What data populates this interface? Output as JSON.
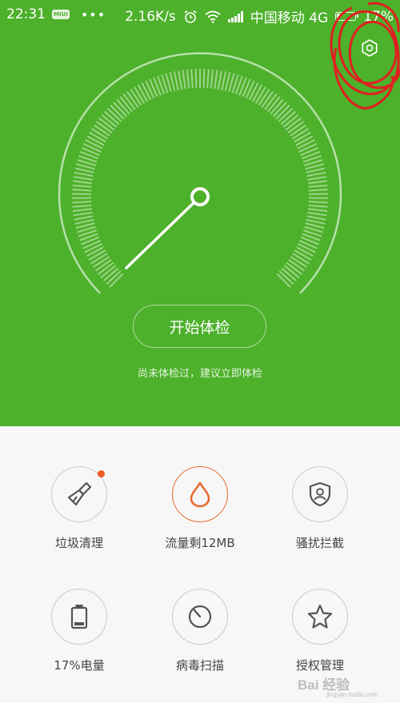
{
  "status_bar": {
    "time": "22:31",
    "app_badge": "MIUI",
    "speed": "2.16K/s",
    "carrier": "中国移动 4G",
    "battery_percent": "17%",
    "battery_level": 0.17,
    "icons": [
      "alarm-icon",
      "wifi-icon",
      "signal-icon",
      "battery-icon"
    ]
  },
  "header": {
    "settings_icon": "gear-icon"
  },
  "gauge": {
    "needle_level": 0.0
  },
  "scan": {
    "button_label": "开始体检",
    "hint": "尚未体检过，建议立即体检"
  },
  "tools": [
    {
      "label": "垃圾清理",
      "icon": "broom-icon",
      "has_badge": true
    },
    {
      "label": "流量剩12MB",
      "icon": "drop-icon",
      "accent": "#e86d33"
    },
    {
      "label": "骚扰拦截",
      "icon": "shield-user-icon"
    },
    {
      "label": "17%电量",
      "icon": "battery-icon"
    },
    {
      "label": "病毒扫描",
      "icon": "virus-scan-icon"
    },
    {
      "label": "授权管理",
      "icon": "star-icon"
    }
  ],
  "watermark": {
    "text": "Bai 经验",
    "sub": "jingyan.baidu.com"
  },
  "colors": {
    "primary_green": "#4db12b",
    "accent_orange": "#e86d33",
    "badge_red": "#f05a2a"
  }
}
